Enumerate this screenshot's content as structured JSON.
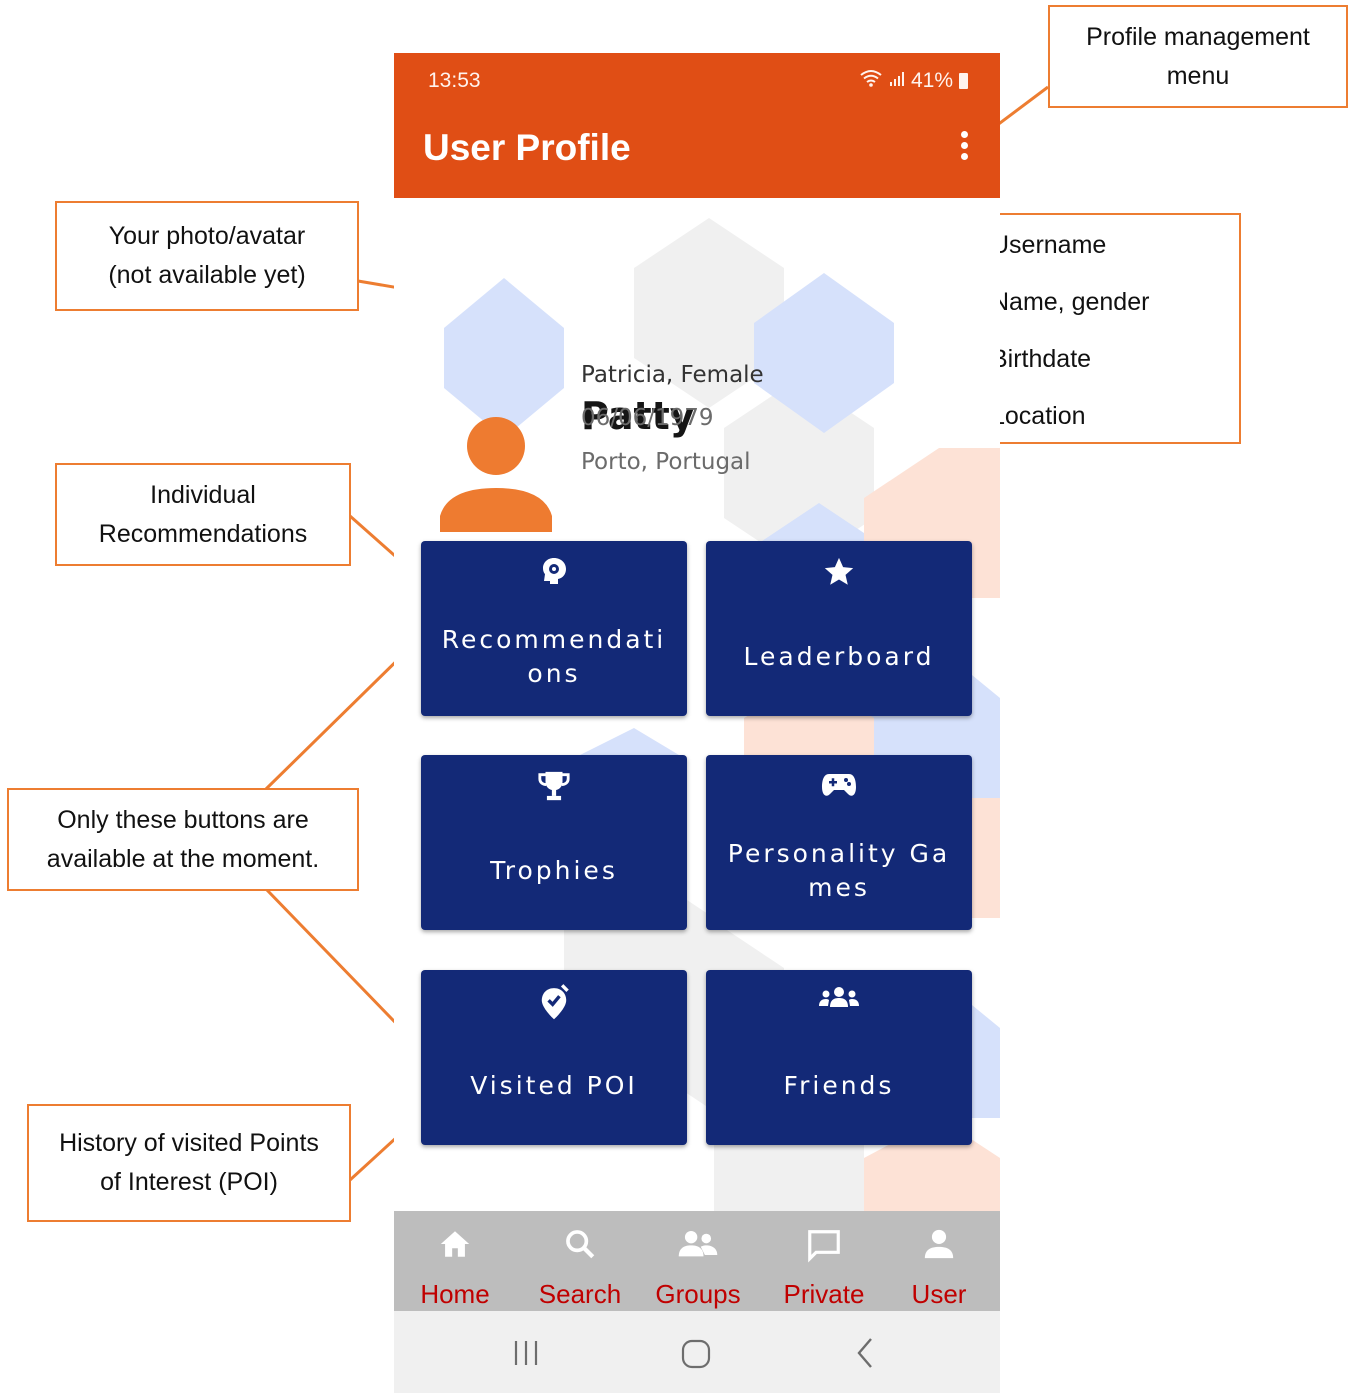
{
  "annotations": {
    "profile_menu": "Profile management menu",
    "avatar": "Your photo/avatar (not available yet)",
    "profile_fields": [
      "Username",
      "Name, gender",
      "Birthdate",
      "Location"
    ],
    "individual_recs": "Individual Recommendations",
    "only_buttons": "Only these buttons are available at the moment.",
    "history_poi": "History of visited Points of Interest (POI)"
  },
  "status": {
    "time": "13:53",
    "battery": "41%"
  },
  "appbar": {
    "title": "User Profile"
  },
  "profile": {
    "username": "Patty",
    "name_gender": "Patricia, Female",
    "birthdate": "06/06/1979",
    "location": "Porto, Portugal"
  },
  "tiles": [
    {
      "label": "Recommendations",
      "icon": "brain-gear-icon"
    },
    {
      "label": "Leaderboard",
      "icon": "star-icon"
    },
    {
      "label": "Trophies",
      "icon": "trophy-icon"
    },
    {
      "label": "Personality Games",
      "icon": "gamepad-icon"
    },
    {
      "label": "Visited POI",
      "icon": "map-pin-check-icon"
    },
    {
      "label": "Friends",
      "icon": "people-group-icon"
    }
  ],
  "bottom_nav": [
    {
      "label": "Home",
      "icon": "home-icon"
    },
    {
      "label": "Search users",
      "icon": "search-icon"
    },
    {
      "label": "Groups",
      "icon": "groups-icon"
    },
    {
      "label": "Private msg",
      "icon": "chat-icon"
    },
    {
      "label": "User profile",
      "icon": "person-icon"
    }
  ],
  "colors": {
    "accent": "#E04E15",
    "tile": "#132977",
    "annotation_border": "#ED7D31",
    "nav_label": "#C00000",
    "avatar": "#EE7B30"
  }
}
